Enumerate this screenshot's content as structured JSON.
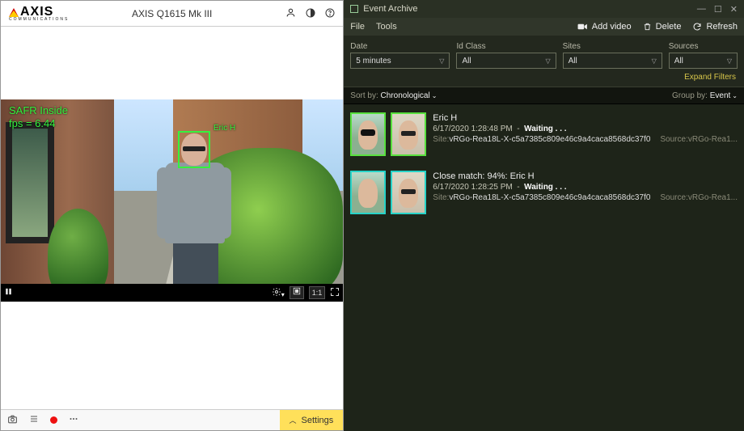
{
  "left": {
    "logo_text": "AXIS",
    "logo_sub": "COMMUNICATIONS",
    "camera_title": "AXIS Q1615 Mk III",
    "overlay_line1": "SAFR Inside",
    "overlay_line2": "fps = 6.44",
    "face_label": "Eric H",
    "video_controls": {
      "ratio": "1:1"
    },
    "footer": {
      "settings": "Settings"
    }
  },
  "right": {
    "title": "Event Archive",
    "menus": {
      "file": "File",
      "tools": "Tools"
    },
    "actions": {
      "add_video": "Add video",
      "delete": "Delete",
      "refresh": "Refresh"
    },
    "filters": {
      "date_label": "Date",
      "date_value": "5 minutes",
      "idclass_label": "Id Class",
      "idclass_value": "All",
      "sites_label": "Sites",
      "sites_value": "All",
      "sources_label": "Sources",
      "sources_value": "All",
      "expand": "Expand Filters"
    },
    "sort": {
      "sort_label": "Sort by:",
      "sort_value": "Chronological",
      "group_label": "Group by:",
      "group_value": "Event"
    },
    "events": [
      {
        "border": "green",
        "name": "Eric H",
        "timestamp": "6/17/2020 1:28:48 PM",
        "status": "Waiting . . .",
        "site_key": "Site:",
        "site_val": "vRGo-Rea18L-X-c5a7385c809e46c9a4caca8568dc37f0",
        "source_key": "Source:",
        "source_val": "vRGo-Rea1..."
      },
      {
        "border": "cyan",
        "name": "Close match: 94%: Eric H",
        "timestamp": "6/17/2020 1:28:25 PM",
        "status": "Waiting . . .",
        "site_key": "Site:",
        "site_val": "vRGo-Rea18L-X-c5a7385c809e46c9a4caca8568dc37f0",
        "source_key": "Source:",
        "source_val": "vRGo-Rea1..."
      }
    ]
  }
}
